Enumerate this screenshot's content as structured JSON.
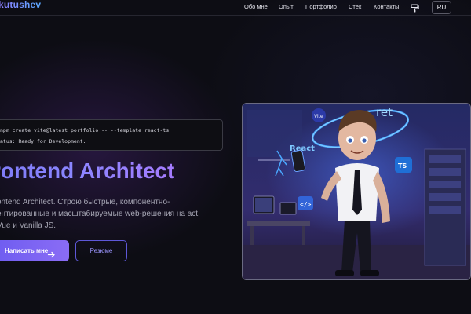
{
  "header": {
    "logo": "kutushev",
    "nav": [
      "Обо мне",
      "Опыт",
      "Портфолио",
      "Стек",
      "Контакты"
    ],
    "theme_icon": "paint-roller-icon",
    "lang": "RU"
  },
  "terminal": {
    "command": "npm create vite@latest portfolio -- --template react-ts",
    "status": "atus: Ready for Development."
  },
  "hero": {
    "title": "rontend Architect",
    "description": "ontend Architect. Строю быстрые, компонентно-ентированные и масштабируемые web-решения на act, Vue и Vanilla JS.",
    "primary_button": "Написать мне",
    "primary_icon": "arrow-right-icon",
    "secondary_button": "Резюме"
  },
  "illustration": {
    "badges": [
      "Vite",
      "React",
      "ret"
    ],
    "icons": [
      "code-brackets-icon",
      "typescript-logo-icon"
    ]
  },
  "colors": {
    "accent": "#7e7bf7",
    "background": "#0d0d14",
    "button_gradient_start": "#6d5cf0",
    "button_gradient_end": "#8a6cf5"
  }
}
